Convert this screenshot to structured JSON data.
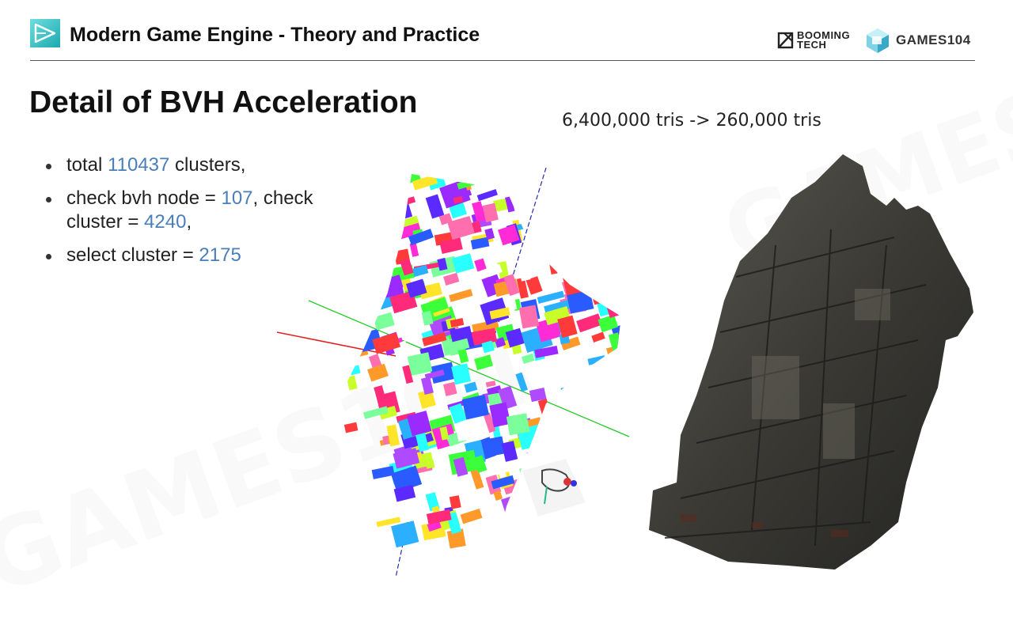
{
  "header": {
    "course_title": "Modern Game Engine - Theory and Practice",
    "brand_booming": "BOOMING TECH",
    "brand_booming_line1": "BOOMING",
    "brand_booming_line2": "TECH",
    "brand_games": "GAMES104"
  },
  "slide": {
    "title": "Detail of BVH Acceleration",
    "bullets": [
      {
        "before": "total ",
        "value": "110437",
        "after": " clusters,"
      },
      {
        "before": "check bvh node = ",
        "value": "107",
        "middle": ", check cluster = ",
        "value2": "4240",
        "after": ","
      },
      {
        "before": "select cluster = ",
        "value": "2175"
      }
    ],
    "caption": "6,400,000 tris -> 260,000 tris"
  },
  "watermarks": [
    "GAMES104",
    "BOOMING TECH"
  ],
  "colors": {
    "accent": "#4a7ebb",
    "logo_teal": "#3fc6c8",
    "rule": "#555555"
  },
  "icons": {
    "header_logo": "play-triangle-icon",
    "booming_logo": "booming-tech-logo",
    "games_logo": "games104-cube-logo"
  }
}
